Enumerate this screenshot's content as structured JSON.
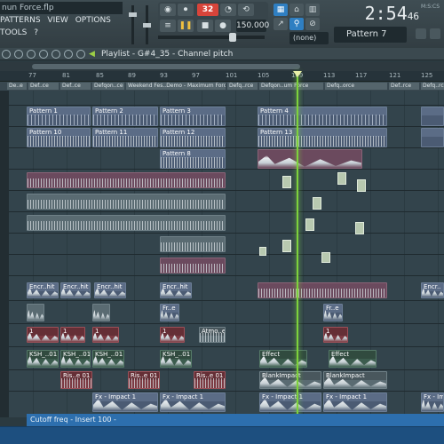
{
  "file_title": "nun Force.flp",
  "menu": [
    "PATTERNS",
    "VIEW",
    "OPTIONS",
    "TOOLS",
    "?"
  ],
  "transport": {
    "pattern_song_led": "32",
    "tempo": "150.000",
    "time": "2:54",
    "time_frac": "46",
    "mode_label": "M:S:CS"
  },
  "snap_select": "(none)",
  "pattern_select": "Pattern 7",
  "playlist_title": "Playlist - G#4_35 - Channel pitch",
  "ruler": [
    "77",
    "81",
    "85",
    "89",
    "93",
    "97",
    "101",
    "105",
    "109",
    "113",
    "117",
    "121",
    "125"
  ],
  "markers": [
    "De..e",
    "Def..ce",
    "Def..ce",
    "Defqon..ce",
    "Weekend Fes..Demo - Maximum Force",
    "Defq..rce",
    "Defqon..um Force",
    "Defq..orce",
    "Def..rce",
    "Defq..rce"
  ],
  "patterns": {
    "p1": "Pattern 1",
    "p2": "Pattern 2",
    "p3": "Pattern 3",
    "p4": "Pattern 4",
    "p10": "Pattern 10",
    "p11": "Pattern 11",
    "p12": "Pattern 12",
    "p13": "Pattern 13",
    "p8": "Pattern 8"
  },
  "clips": {
    "encr1": "Encr..hit",
    "encr2": "Encr..hit",
    "encr3": "Encr..hit",
    "encr4": "Encr..hit",
    "encr5": "Encr..",
    "fre1": "Fr..e",
    "fre2": "Fr..e",
    "one1": "1",
    "one2": "1",
    "one3": "1",
    "one4": "1",
    "one5": "1",
    "atmo": "Atmo..er",
    "ksh1": "KSH_..01",
    "ksh2": "KSH_..01",
    "ksh3": "KSH_..01",
    "ksh4": "KSH_..01",
    "effect1": "Effect",
    "effect2": "Effect",
    "rise1": "Ris..e 01",
    "rise2": "Ris..e 01",
    "rise3": "Ris..e 01",
    "blank1": "BlankImpact",
    "blank2": "BlankImpact",
    "fx1": "Fx - Impact 1",
    "fx2": "Fx - Impact 1",
    "fx3": "Fx - Impact 1",
    "fx4": "Fx - Impact 1",
    "fx5": "Fx - Im"
  },
  "automation_label": "Cutoff freq - Insert 100 -",
  "colors": {
    "accent": "#2f7fc2",
    "playhead": "#7ed23c",
    "led": "#d8443a"
  }
}
